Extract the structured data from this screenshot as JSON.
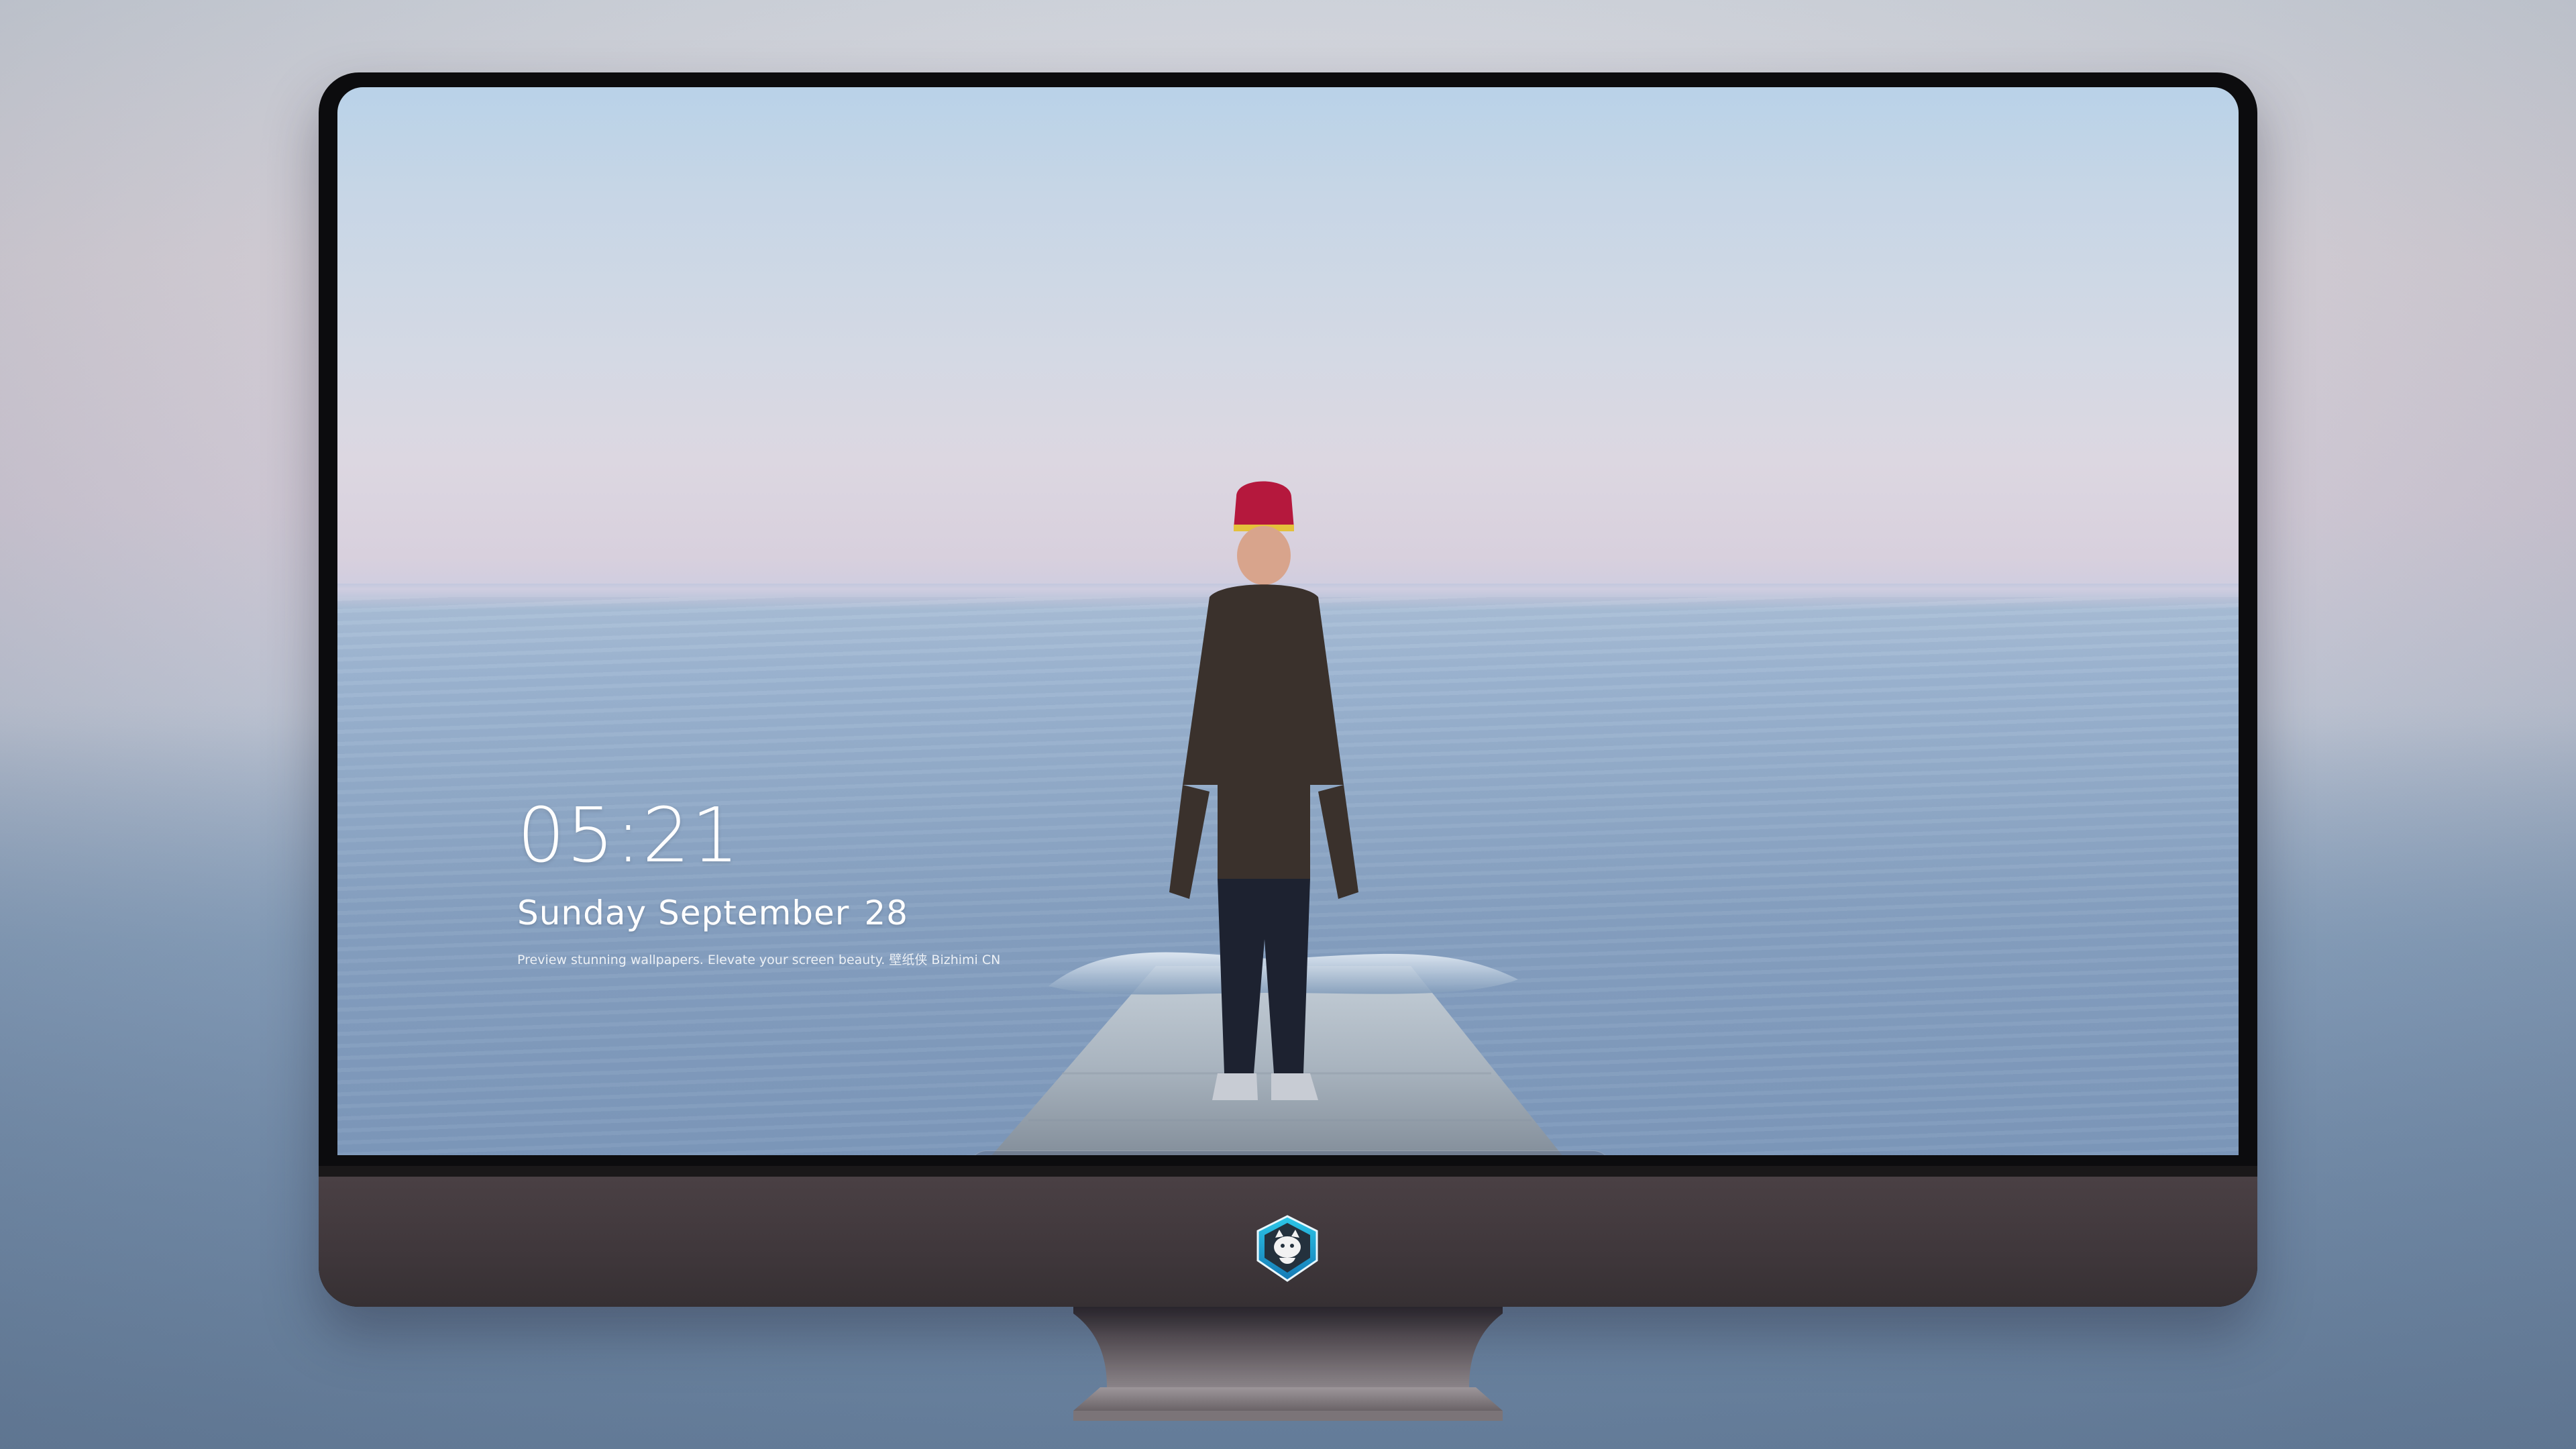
{
  "lockscreen": {
    "time": "05:21",
    "date_weekday_month": "Sunday September",
    "date_day": "28",
    "tagline": "Preview stunning wallpapers. Elevate your screen beauty. 壁纸侠 Bizhimi CN"
  },
  "dock": {
    "apps": [
      {
        "name": "messages-icon",
        "color": "#34c759"
      },
      {
        "name": "weather-icon",
        "color": "#2f8df5"
      },
      {
        "name": "clock-icon",
        "color": "#111111"
      },
      {
        "name": "preview-icon",
        "color": "#f5c542"
      },
      {
        "name": "clapperboard-icon",
        "color": "#2ea7e0"
      },
      {
        "name": "notes-icon",
        "color": "#fbd64a"
      },
      {
        "name": "photo-booth-icon",
        "color": "#f2f2f2"
      },
      {
        "name": "music-icon",
        "color": "#e33fd6"
      },
      {
        "name": "app-store-icon",
        "color": "#1d8cf8"
      },
      {
        "name": "camera-icon",
        "color": "#6d6d72"
      }
    ]
  },
  "colors": {
    "monitor_bezel": "#0c0c0e",
    "monitor_chin": "#3f373b",
    "text": "#ffffff"
  }
}
